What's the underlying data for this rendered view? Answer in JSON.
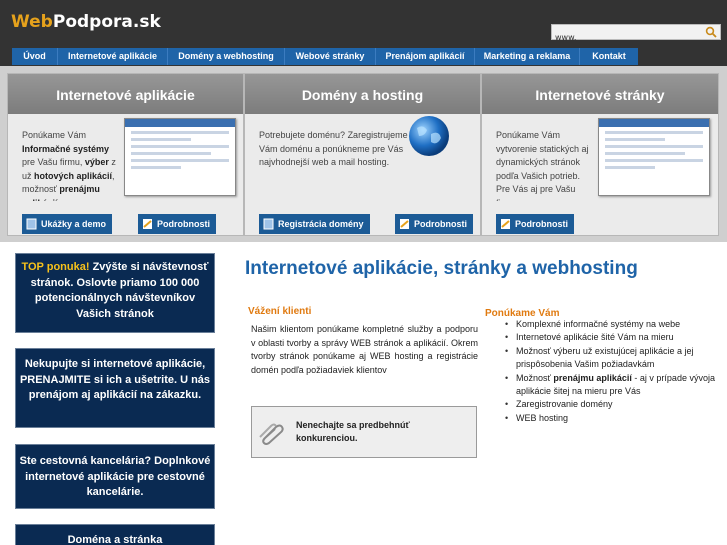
{
  "logo": {
    "part1": "Web",
    "part2": "Podpora.sk"
  },
  "search": {
    "value": "www."
  },
  "nav": [
    "Úvod",
    "Internetové aplikácie",
    "Domény a webhosting",
    "Webové stránky",
    "Prenájom aplikácií",
    "Marketing a reklama",
    "Kontakt"
  ],
  "panels": {
    "apps": {
      "title": "Internetové aplikácie",
      "t1": "Ponúkame Vám ",
      "t2": "Informačné systémy",
      "t3": " pre Vašu firmu, ",
      "t4": "výber",
      "t5": " z už ",
      "t6": "hotových aplikácií",
      "t7": ", možnosť ",
      "t8": "prenájmu aplikácií",
      "btn1": "Ukážky a demo",
      "btn2": "Podrobnosti"
    },
    "domains": {
      "title": "Domény a hosting",
      "text": "Potrebujete doménu? Zaregistrujeme Vám doménu a ponúkneme pre Vás najvhodnejší web a mail hosting.",
      "btn1": "Registrácia domény",
      "btn2": "Podrobnosti"
    },
    "web": {
      "title": "Internetové stránky",
      "text": "Ponúkame Vám vytvorenie statických aj dynamických stránok podľa Vašich potrieb. Pre Vás aj pre Vašu firmu.",
      "btn1": "Podrobnosti"
    }
  },
  "banners": {
    "b1": {
      "hl": "TOP ponuka!",
      "text": " Zvýšte si návštevnosť stránok. Oslovte priamo 100 000 potencionálnych návštevníkov Vašich stránok"
    },
    "b2": "Nekupujte si internetové aplikácie, PRENAJMITE si ich a ušetrite. U nás prenájom aj aplikácií na zákazku.",
    "b3": "Ste cestovná kancelária? Doplnkové internetové aplikácie pre cestovné kancelárie.",
    "b4": "Doména a stránka"
  },
  "main": {
    "heading": "Internetové aplikácie, stránky a webhosting",
    "clients": {
      "title": "Vážení klienti",
      "text": "Našim klientom ponúkame kompletné služby a podporu v oblasti tvorby a správy WEB stránok a aplikácií. Okrem tvorby stránok ponúkame aj WEB hosting a registrácie domén podľa požiadaviek klientov"
    },
    "note": "Nenechajte sa predbehnúť konkurenciou.",
    "offer": {
      "title": "Ponúkame Vám",
      "items": {
        "i1": "Komplexné informačné systémy na webe",
        "i2": "Internetové aplikácie šité Vám na mieru",
        "i3": "Možnosť výberu už existujúcej aplikácie a jej prispôsobenia Vašim požiadavkám",
        "i4a": "Možnosť ",
        "i4b": "prenájmu aplikácií",
        "i4c": " - aj v prípade vývoja aplikácie šitej na mieru pre Vás",
        "i5": "Zaregistrovanie domény",
        "i6": "WEB hosting"
      }
    }
  },
  "colors": {
    "nav": "#1f64a8",
    "accent": "#e6a21c",
    "banner": "#0a2a52",
    "highlight": "#f7c21b",
    "heading": "#1f64a8",
    "subheading": "#e07a10"
  }
}
